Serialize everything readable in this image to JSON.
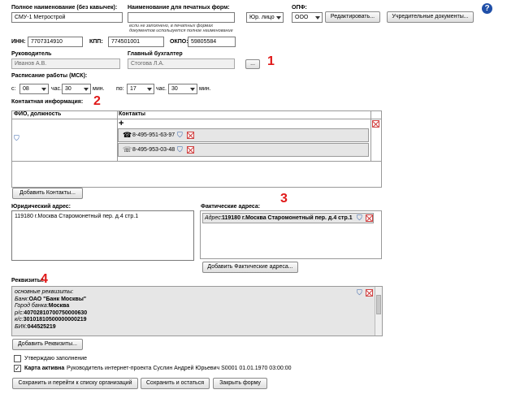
{
  "help_icon": "question-circle-icon",
  "header": {
    "full_name_label": "Полное наименование (без кавычек):",
    "full_name_value": "СМУ-1 Метрострой",
    "print_name_label": "Наименование для печатных форм:",
    "print_name_value": "",
    "print_name_hint_1": "если не заполнено, в печатных формах",
    "print_name_hint_2": "документов используется полное наименование",
    "entity_type_value": "Юр. лицо",
    "opf_label": "ОПФ:",
    "opf_value": "ООО",
    "edit_button": "Редактировать...",
    "founding_docs_button": "Учредительные документы..."
  },
  "ids": {
    "inn_label": "ИНН:",
    "inn_value": "7707314910",
    "kpp_label": "КПП:",
    "kpp_value": "774501001",
    "okpo_label": "ОКПО:",
    "okpo_value": "59805584"
  },
  "people": {
    "director_label": "Руководитель",
    "director_value": "Иванов А.В.",
    "accountant_label": "Главный бухгалтер",
    "accountant_value": "Стогова Л.А.",
    "more_button": "..."
  },
  "schedule": {
    "title": "Расписание работы (МСК):",
    "from_label": "с:",
    "from_hour": "08",
    "hour_label": "час.",
    "from_min": "30",
    "min_label": "мин.",
    "to_label": "по:",
    "to_hour": "17",
    "to_min": "30"
  },
  "contacts": {
    "title": "Контактная информация:",
    "col_person": "ФИО, должность",
    "col_contacts": "Контакты",
    "add_sign": "+",
    "phones": [
      {
        "icon": "phone-icon",
        "number": "8-495-951-63-97"
      },
      {
        "icon": "fax-icon",
        "number": "8-495-953-03-48"
      }
    ],
    "add_button": "Добавить Контакты..."
  },
  "addresses": {
    "legal_label": "Юридический адрес:",
    "legal_value": "119180 г.Москва Старомонетный пер. д.4 стр.1",
    "actual_label": "Фактические адреса:",
    "actual_prefix": "Адрес:",
    "actual_value": "119180 г.Москва Старомонетный пер. д.4 стр.1",
    "add_actual_button": "Добавить Фактические адреса..."
  },
  "requisites": {
    "title": "Реквизиты:",
    "lines": [
      {
        "label": "основные реквизиты:",
        "value": ""
      },
      {
        "label": "Банк:",
        "value": "ОАО \"Банк Москвы\""
      },
      {
        "label": "Город банка:",
        "value": "Москва"
      },
      {
        "label": "р/с:",
        "value": "40702810700750000630"
      },
      {
        "label": "к/с:",
        "value": "30101810500000000219"
      },
      {
        "label": "БИК:",
        "value": "044525219"
      }
    ],
    "add_button": "Добавить Реквизиты..."
  },
  "footer": {
    "approve_label": "Утверждаю заполнение",
    "card_active_label": "Карта активна",
    "card_active_info": "Руководитель интернет-проекта Суслин Андрей Юрьевич S0001 01.01.1970 03:00:00",
    "save_back_button": "Сохранить и перейти к списку организаций",
    "save_stay_button": "Сохранить и остаться",
    "close_button": "Закрыть форму"
  },
  "annotations": [
    "1",
    "2",
    "3",
    "4"
  ],
  "colors": {
    "annotation": "#e01818",
    "icon_blue": "#2f5da8",
    "delete_red": "#d04040"
  }
}
